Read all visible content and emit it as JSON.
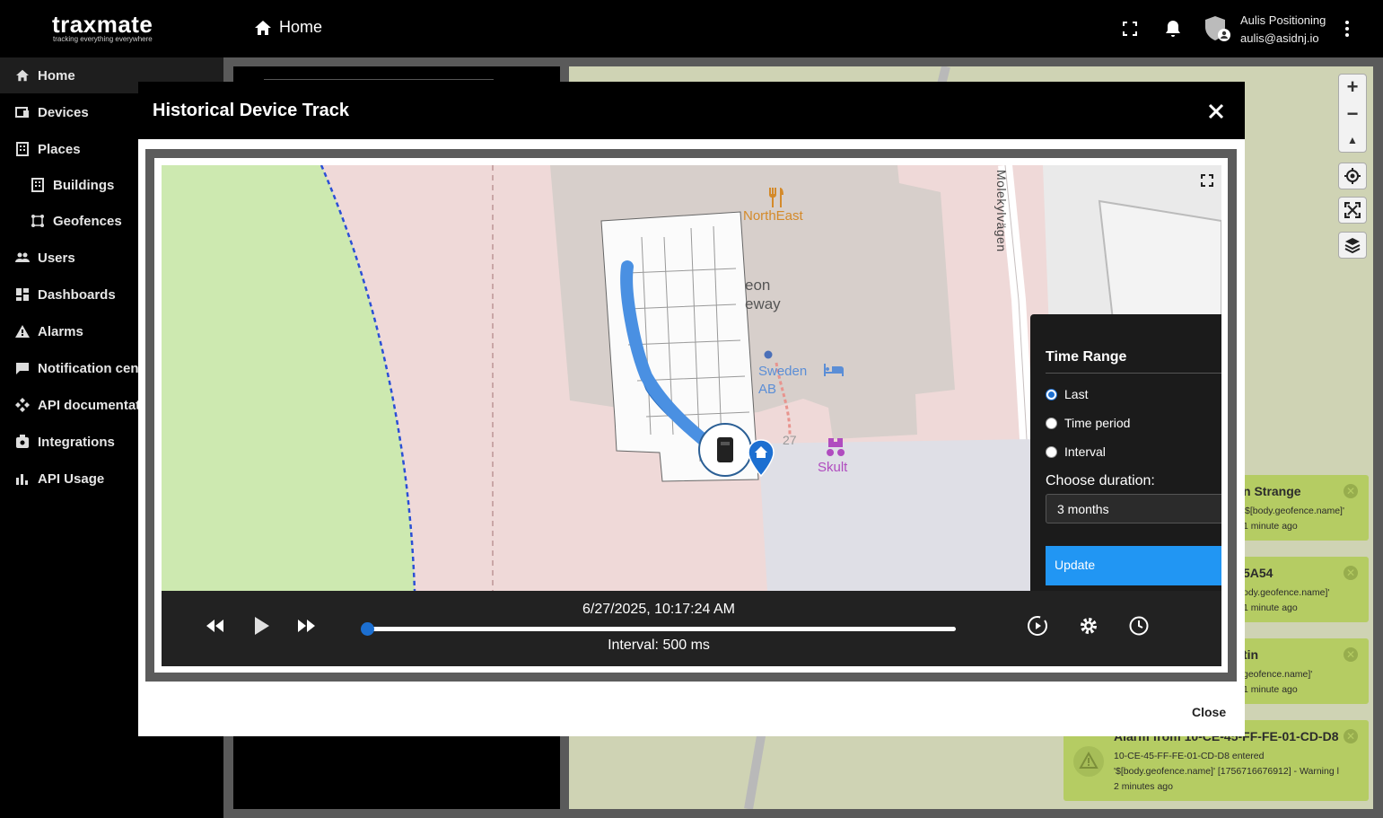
{
  "header": {
    "logo": "traxmate",
    "logo_tagline": "tracking everything everywhere",
    "breadcrumb": "Home",
    "user_name": "Aulis Positioning",
    "user_email": "aulis@asidnj.io"
  },
  "sidebar": {
    "items": [
      {
        "label": "Home",
        "icon": "home-icon"
      },
      {
        "label": "Devices",
        "icon": "devices-icon"
      },
      {
        "label": "Places",
        "icon": "places-icon"
      },
      {
        "label": "Buildings",
        "icon": "building-icon"
      },
      {
        "label": "Geofences",
        "icon": "geofence-icon"
      },
      {
        "label": "Users",
        "icon": "users-icon"
      },
      {
        "label": "Dashboards",
        "icon": "dashboard-icon"
      },
      {
        "label": "Alarms",
        "icon": "warning-icon"
      },
      {
        "label": "Notification cent",
        "icon": "notification-icon"
      },
      {
        "label": "API documentati",
        "icon": "api-icon"
      },
      {
        "label": "Integrations",
        "icon": "integrations-icon"
      },
      {
        "label": "API Usage",
        "icon": "usage-icon"
      }
    ]
  },
  "modal": {
    "title": "Historical Device Track",
    "close_label": "Close",
    "timestamp": "6/27/2025, 10:17:24 AM",
    "interval": "Interval: 500 ms",
    "progress": 0
  },
  "map_labels": {
    "poi_1": "NorthEast",
    "street": "Molekylvägen",
    "poi_2a": "eon",
    "poi_2b": "eway",
    "poi_3a": "Sweden",
    "poi_3b": "AB",
    "poi_4": "Skult",
    "number": "27"
  },
  "time_range": {
    "title": "Time Range",
    "options": [
      "Last",
      "Time period",
      "Interval"
    ],
    "selected": "Last",
    "duration_label": "Choose duration:",
    "duration_value": "3 months",
    "update_label": "Update"
  },
  "toasts": [
    {
      "title": "n Strange",
      "line1": "'$[body.geofence.name]'",
      "line2": "1 minute ago"
    },
    {
      "title": "5A54",
      "line1": "ody.geofence.name]'",
      "line2": "1 minute ago"
    },
    {
      "title": "tin",
      "line1": "geofence.name]'",
      "line2": "1 minute ago"
    },
    {
      "title": "Alarm from 10-CE-45-FF-FE-01-CD-D8",
      "line1": "10-CE-45-FF-FE-01-CD-D8 entered",
      "line2": "'$[body.geofence.name]' [1756716676912] - Warning l",
      "line3": "2 minutes ago"
    }
  ],
  "colors": {
    "accent": "#2196f3",
    "toast": "#b5cc63",
    "track": "#4a90e2"
  }
}
